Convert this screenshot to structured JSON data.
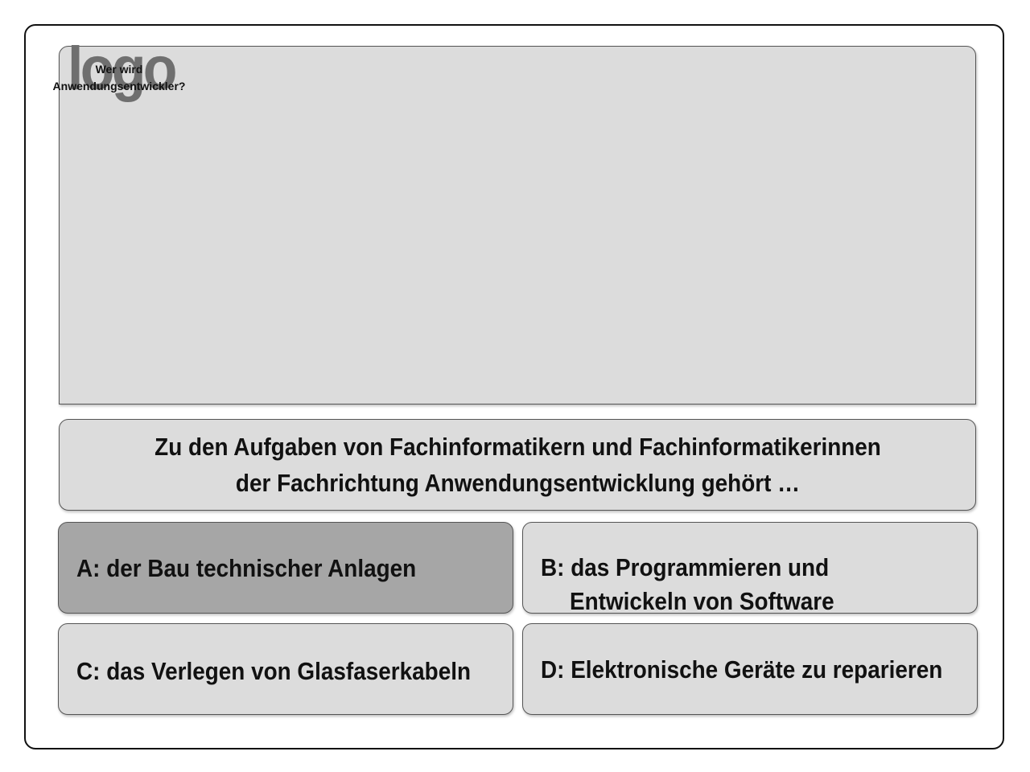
{
  "header": {
    "logo_text": "logo",
    "caption_line1": "Wer wird",
    "caption_line2": "Anwendungsentwickler?"
  },
  "question": {
    "line1": "Zu den Aufgaben von Fachinformatikern und Fachinformatikerinnen",
    "line2": "der Fachrichtung Anwendungsentwicklung gehört …"
  },
  "answers": {
    "a": "A: der Bau technischer Anlagen",
    "b_line1": "B: das Programmieren und",
    "b_line2": "Entwickeln von Software",
    "c": "C: das Verlegen von Glasfaserkabeln",
    "d": "D: Elektronische Geräte zu reparieren"
  },
  "colors": {
    "panel": "#dcdcdc",
    "selected": "#a6a6a6",
    "logo": "#6f6f6f",
    "text": "#111111"
  }
}
